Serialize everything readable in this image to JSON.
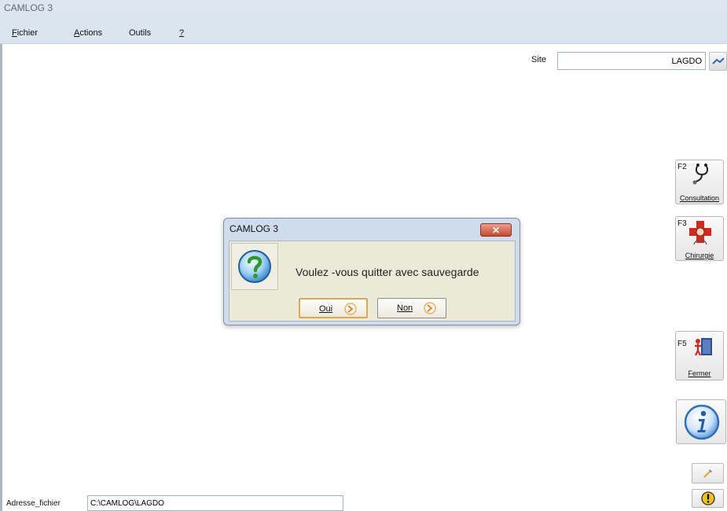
{
  "window": {
    "title": "CAMLOG 3"
  },
  "menu": [
    {
      "accel": "F",
      "rest": "ichier"
    },
    {
      "accel": "A",
      "rest": "ctions"
    },
    {
      "accel": "",
      "rest": "Outils"
    },
    {
      "accel": "?",
      "rest": ""
    }
  ],
  "site": {
    "label": "Site",
    "value": "LAGDO"
  },
  "function_keys": {
    "consultation": {
      "key": "F2",
      "label": "Consultation"
    },
    "chirurgie": {
      "key": "F3",
      "label": "Chirurgie"
    },
    "fermer": {
      "key": "F5",
      "label": "Fermer"
    }
  },
  "address": {
    "label": "Adresse_fichier",
    "value": "C:\\CAMLOG\\LAGDO"
  },
  "dialog": {
    "title": "CAMLOG 3",
    "message": "Voulez -vous quitter avec sauvegarde",
    "yes_label": "Oui",
    "no_label": "Non"
  },
  "icons": {
    "question": "question-icon",
    "info": "info-icon",
    "warning": "warning-icon",
    "stethoscope": "stethoscope-icon",
    "surgeon": "surgeon-icon",
    "exit": "exit-door-icon"
  },
  "colors": {
    "menubar": "#dae5f0",
    "dialog_body": "#ebe9d8",
    "close_button": "#c9472e",
    "default_button_border": "#e2a949"
  }
}
